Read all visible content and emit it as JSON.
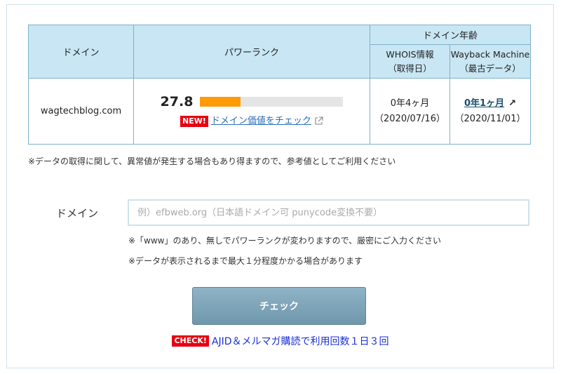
{
  "table": {
    "header_domain": "ドメイン",
    "header_power_rank": "パワーランク",
    "header_domain_age": "ドメイン年齢",
    "header_whois_1": "WHOIS情報",
    "header_whois_2": "（取得日）",
    "header_wayback_1": "Wayback Machine",
    "header_wayback_2": "（最古データ）",
    "domain": "wagtechblog.com",
    "power_rank": "27.8",
    "power_rank_fraction": 0.28,
    "new_badge": "NEW!",
    "value_link": "ドメイン価値をチェック",
    "whois_age": "0年4ヶ月",
    "whois_date": "（2020/07/16）",
    "wayback_age": "0年1ヶ月",
    "wayback_date": "（2020/11/01）"
  },
  "notes": {
    "data_disclaimer": "※データの取得に関して、異常値が発生する場合もあり得ますので、参考値としてご利用ください",
    "www_note": "※「www」のあり、無しでパワーランクが変わりますので、厳密にご入力ください",
    "time_note": "※データが表示されるまで最大１分程度かかる場合があります"
  },
  "form": {
    "domain_label": "ドメイン",
    "domain_placeholder": "例）efbweb.org（日本語ドメイン可 punycode変換不要）",
    "check_button": "チェック"
  },
  "promo": {
    "badge": "CHECK!",
    "link": "AJID＆メルマガ購読で利用回数１日３回"
  },
  "colors": {
    "bar_fill": "#ff9b06",
    "badge_red": "#e60012",
    "header_bg": "#c8e6f3"
  }
}
